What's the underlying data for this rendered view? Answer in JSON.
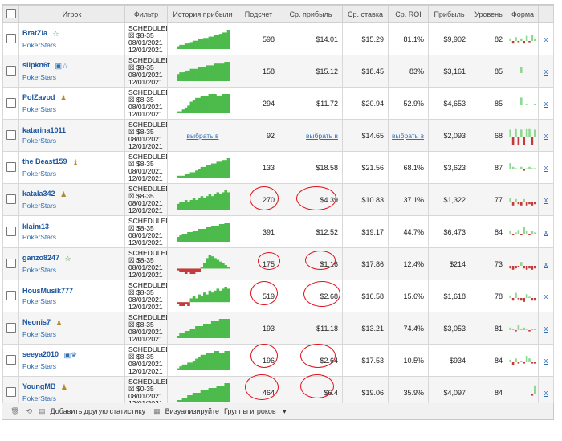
{
  "columns": [
    "Игрок",
    "Фильтр",
    "История прибыли",
    "Подсчет",
    "Ср. прибыль",
    "Ср. ставка",
    "Ср. ROI",
    "Прибыль",
    "Уровень",
    "Форма"
  ],
  "rows": [
    {
      "name": "BratZla",
      "site": "PokerStars",
      "icons": "☆",
      "icon_type": "star",
      "filter": [
        "SCHEDULED",
        "☒ $8-35",
        "08/01/2021",
        "12/01/2021"
      ],
      "count": "598",
      "avg_profit": "$14.01",
      "avg_stake": "$15.29",
      "roi": "81.1%",
      "profit": "$9,902",
      "level": "82",
      "history": [
        2,
        3,
        3,
        4,
        4,
        5,
        6,
        6,
        7,
        7,
        8,
        8,
        9,
        9,
        10,
        10,
        11,
        12,
        12,
        14
      ],
      "form": [
        2,
        -2,
        3,
        -1,
        2,
        -2,
        4,
        -1,
        5,
        2
      ]
    },
    {
      "name": "slipkn6t",
      "site": "PokerStars",
      "icons": "▣☆",
      "icon_type": "box-star",
      "filter": [
        "SCHEDULED",
        "☒ $8-35",
        "08/01/2021",
        "12/01/2021"
      ],
      "count": "158",
      "avg_profit": "$15.12",
      "avg_stake": "$18.45",
      "roi": "83%",
      "profit": "$3,161",
      "level": "85",
      "history": [
        4,
        5,
        5,
        6,
        6,
        7,
        7,
        7,
        8,
        8,
        8,
        9,
        9,
        9,
        10,
        10,
        10,
        10,
        11,
        11
      ],
      "form": [
        0,
        0,
        0,
        0,
        5,
        0,
        0,
        0,
        0,
        0
      ]
    },
    {
      "name": "PolZavod",
      "site": "PokerStars",
      "icons": "♟",
      "icon_type": "pawn",
      "filter": [
        "SCHEDULED",
        "☒ $8-35",
        "08/01/2021",
        "12/01/2021"
      ],
      "count": "294",
      "avg_profit": "$11.72",
      "avg_stake": "$20.94",
      "roi": "52.9%",
      "profit": "$4,653",
      "level": "85",
      "history": [
        1,
        1,
        2,
        3,
        4,
        6,
        7,
        8,
        8,
        9,
        9,
        9,
        10,
        10,
        10,
        9,
        9,
        10,
        10,
        10
      ],
      "form": [
        0,
        0,
        0,
        0,
        6,
        0,
        1,
        0,
        0,
        1
      ]
    },
    {
      "name": "katarina1011",
      "site": "PokerStars",
      "icons": "",
      "icon_type": "none",
      "filter": [
        "SCHEDULED",
        "☒ $8-35",
        "08/01/2021",
        "12/01/2021"
      ],
      "count": "92",
      "avg_profit": "выбрать в",
      "avg_stake": "$14.65",
      "roi": "выбрать в",
      "profit": "$2,093",
      "level": "68",
      "history": [],
      "form": [
        6,
        -6,
        7,
        -7,
        6,
        -6,
        7,
        7,
        -6,
        6
      ],
      "history_link": "выбрать в"
    },
    {
      "name": "the Beast159",
      "site": "PokerStars",
      "icons": "♝",
      "icon_type": "pawn",
      "filter": [
        "SCHEDULED",
        "☒ $8-35",
        "08/01/2021",
        "12/01/2021"
      ],
      "count": "133",
      "avg_profit": "$18.58",
      "avg_stake": "$21.56",
      "roi": "68.1%",
      "profit": "$3,623",
      "level": "87",
      "history": [
        1,
        1,
        1,
        2,
        2,
        3,
        3,
        4,
        5,
        6,
        6,
        7,
        7,
        8,
        8,
        9,
        9,
        10,
        10,
        11
      ],
      "form": [
        5,
        2,
        1,
        0,
        2,
        -1,
        1,
        2,
        1,
        1
      ]
    },
    {
      "name": "katala342",
      "site": "PokerStars",
      "icons": "♟",
      "icon_type": "pawn",
      "filter": [
        "SCHEDULED",
        "☒ $8-35",
        "08/01/2021",
        "12/01/2021"
      ],
      "count": "270",
      "avg_profit": "$4.39",
      "avg_stake": "$10.83",
      "roi": "37.1%",
      "profit": "$1,322",
      "level": "77",
      "history": [
        3,
        4,
        4,
        5,
        4,
        5,
        6,
        5,
        6,
        7,
        6,
        7,
        8,
        7,
        8,
        9,
        8,
        9,
        10,
        9
      ],
      "form": [
        3,
        -3,
        2,
        -2,
        -3,
        2,
        -3,
        -2,
        -3,
        -2
      ]
    },
    {
      "name": "klaim13",
      "site": "PokerStars",
      "icons": "",
      "icon_type": "none",
      "filter": [
        "SCHEDULED",
        "☒ $8-35",
        "08/01/2021",
        "12/01/2021"
      ],
      "count": "391",
      "avg_profit": "$12.52",
      "avg_stake": "$19.17",
      "roi": "44.7%",
      "profit": "$6,473",
      "level": "84",
      "history": [
        3,
        4,
        5,
        5,
        6,
        6,
        7,
        7,
        8,
        8,
        8,
        9,
        9,
        10,
        10,
        10,
        11,
        11,
        12,
        12
      ],
      "form": [
        2,
        -1,
        1,
        3,
        -1,
        5,
        2,
        -1,
        2,
        1
      ]
    },
    {
      "name": "ganzo8247",
      "site": "PokerStars",
      "icons": "☆",
      "icon_type": "star",
      "filter": [
        "SCHEDULED",
        "☒ $8-35",
        "08/01/2021",
        "12/01/2021"
      ],
      "count": "175",
      "avg_profit": "$1.16",
      "avg_stake": "$17.86",
      "roi": "12.4%",
      "profit": "$214",
      "level": "73",
      "history": [
        -1,
        -2,
        -2,
        -3,
        -2,
        -3,
        -3,
        -2,
        -2,
        1,
        3,
        6,
        8,
        7,
        6,
        5,
        4,
        3,
        2,
        1
      ],
      "form": [
        -2,
        -3,
        -2,
        -1,
        3,
        -2,
        -3,
        -2,
        -3,
        -2
      ]
    },
    {
      "name": "HousMusik777",
      "site": "PokerStars",
      "icons": "",
      "icon_type": "none",
      "filter": [
        "SCHEDULED",
        "☒ $8-35",
        "08/01/2021",
        "12/01/2021"
      ],
      "count": "519",
      "avg_profit": "$2.68",
      "avg_stake": "$16.58",
      "roi": "15.6%",
      "profit": "$1,618",
      "level": "78",
      "history": [
        -1,
        -2,
        -2,
        -1,
        -2,
        2,
        3,
        2,
        4,
        3,
        5,
        4,
        6,
        5,
        6,
        7,
        6,
        7,
        8,
        7
      ],
      "form": [
        2,
        -2,
        4,
        -1,
        -2,
        -3,
        3,
        1,
        -2,
        -2
      ]
    },
    {
      "name": "Neonis7",
      "site": "PokerStars",
      "icons": "♟",
      "icon_type": "pawn",
      "filter": [
        "SCHEDULED",
        "☒ $8-35",
        "08/01/2021",
        "12/01/2021"
      ],
      "count": "193",
      "avg_profit": "$11.18",
      "avg_stake": "$13.21",
      "roi": "74.4%",
      "profit": "$3,053",
      "level": "81",
      "history": [
        1,
        2,
        2,
        3,
        3,
        4,
        4,
        5,
        5,
        5,
        6,
        6,
        6,
        7,
        7,
        7,
        8,
        8,
        8,
        8
      ],
      "form": [
        2,
        1,
        -1,
        4,
        1,
        2,
        1,
        -1,
        1,
        1
      ]
    },
    {
      "name": "seeya2010",
      "site": "PokerStars",
      "icons": "▣♛",
      "icon_type": "box-trophy",
      "filter": [
        "SCHEDULED",
        "☒ $8-35",
        "08/01/2021",
        "12/01/2021"
      ],
      "count": "196",
      "avg_profit": "$2.64",
      "avg_stake": "$17.53",
      "roi": "10.5%",
      "profit": "$934",
      "level": "84",
      "history": [
        1,
        2,
        3,
        3,
        4,
        4,
        5,
        6,
        7,
        8,
        8,
        9,
        9,
        9,
        10,
        10,
        9,
        9,
        10,
        10
      ],
      "form": [
        2,
        -2,
        3,
        -1,
        1,
        -1,
        5,
        3,
        -1,
        -1
      ]
    },
    {
      "name": "YoungMB",
      "site": "PokerStars",
      "icons": "♟",
      "icon_type": "pawn",
      "filter": [
        "SCHEDULED",
        "☒ $0-35",
        "08/01/2021",
        "12/01/2021"
      ],
      "count": "464",
      "avg_profit": "$6.4",
      "avg_stake": "$19.06",
      "roi": "35.9%",
      "profit": "$4,097",
      "level": "84",
      "history": [
        1,
        1,
        2,
        2,
        3,
        3,
        4,
        4,
        4,
        5,
        5,
        5,
        6,
        6,
        6,
        7,
        7,
        7,
        8,
        8
      ],
      "form": [
        0,
        0,
        0,
        0,
        0,
        0,
        0,
        0,
        -1,
        7
      ]
    }
  ],
  "row_close": "x",
  "footer": {
    "add_stat": "Добавить другую статистику",
    "visualize": "Визуализируйте",
    "groups": "Группы игроков"
  },
  "colors": {
    "profit_green": "#4cbb4c",
    "loss_red": "#c43a3a",
    "link_blue": "#2d6db5",
    "annotation_red": "#e0101a"
  }
}
